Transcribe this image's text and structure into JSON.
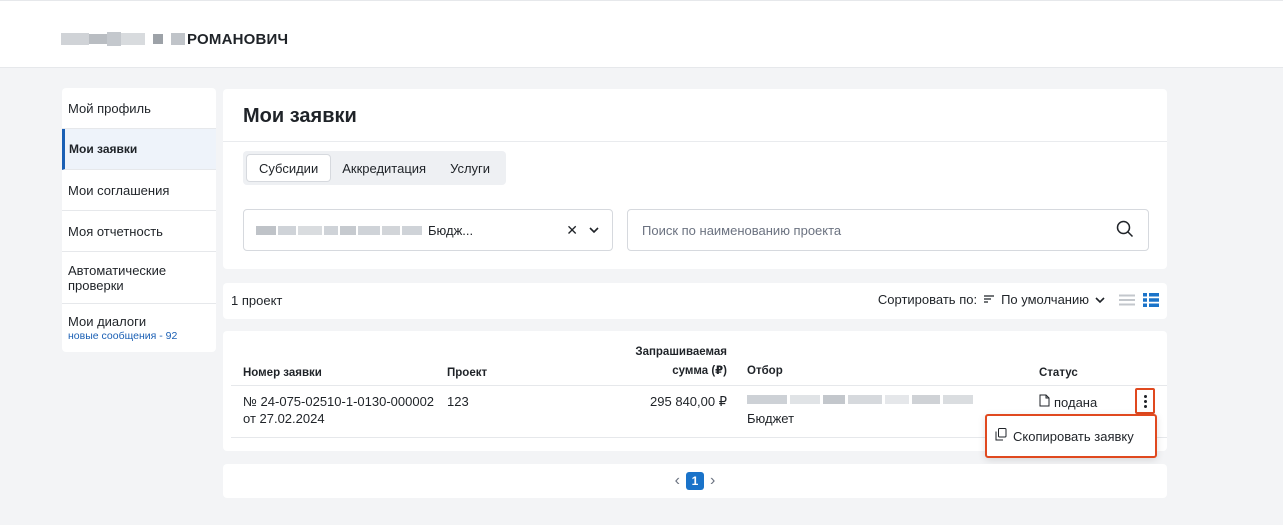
{
  "user": {
    "surname": "РОМАНОВИЧ"
  },
  "sidebar": {
    "items": [
      {
        "label": "Мой профиль"
      },
      {
        "label": "Мои заявки"
      },
      {
        "label": "Мои соглашения"
      },
      {
        "label": "Моя отчетность"
      },
      {
        "label": "Автоматические проверки"
      },
      {
        "label": "Мои диалоги",
        "sub": "новые сообщения - 92"
      }
    ]
  },
  "main": {
    "title": "Мои заявки",
    "tabs": [
      {
        "label": "Субсидии"
      },
      {
        "label": "Аккредитация"
      },
      {
        "label": "Услуги"
      }
    ],
    "filter": {
      "value": "Бюдж..."
    },
    "search": {
      "placeholder": "Поиск по наименованию проекта"
    }
  },
  "summary": {
    "count": "1 проект",
    "sort_label": "Сортировать по:",
    "sort_value": "По умолчанию"
  },
  "table": {
    "headers": {
      "number": "Номер заявки",
      "project": "Проект",
      "amount_1": "Запрашиваемая",
      "amount_2": "сумма (₽)",
      "selection": "Отбор",
      "status": "Статус"
    },
    "row": {
      "number": "№ 24-075-02510-1-0130-000002",
      "date": "от 27.02.2024",
      "project": "123",
      "amount": "295 840,00 ₽",
      "selection": "Бюджет",
      "status": "подана"
    }
  },
  "context_menu": {
    "copy_label": "Скопировать заявку"
  },
  "pagination": {
    "current": "1"
  },
  "colors": {
    "accent": "#1a73c9",
    "highlight": "#e0491f"
  }
}
